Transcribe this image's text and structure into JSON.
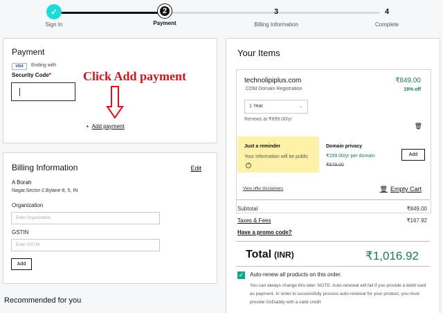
{
  "stepper": {
    "steps": [
      {
        "number": "✓",
        "label": "Sign In"
      },
      {
        "number": "2",
        "label": "Payment"
      },
      {
        "number": "3",
        "label": "Billing Information"
      },
      {
        "number": "4",
        "label": "Complete"
      }
    ]
  },
  "payment": {
    "title": "Payment",
    "card_brand": "VISA",
    "ending_text": "Ending with",
    "security_label": "Security Code",
    "required_mark": "*",
    "annotation": "Click Add payment",
    "add_payment_plus": "+",
    "add_payment_label": "Add payment"
  },
  "billing": {
    "title": "Billing Information",
    "edit_label": "Edit",
    "name": "A Borah",
    "address": "Nagar,Sector-2,Bylane-8,  5, IN",
    "organization_label": "Organization",
    "organization_placeholder": "Enter Organization",
    "gstin_label": "GSTIN",
    "gstin_placeholder": "Enter GSTIN",
    "add_label": "Add"
  },
  "recommended": {
    "title": "Recommended for you"
  },
  "items": {
    "title": "Your Items",
    "product": {
      "name": "technolipiplus.com",
      "price": "₹849.00",
      "description": ".COM Domain Registration",
      "discount": "19% off",
      "term": "1 Year",
      "renews": "Renews at ₹899.00/yr"
    },
    "reminder": {
      "title": "Just a reminder",
      "body": "Your information will be public"
    },
    "privacy": {
      "title": "Domain privacy",
      "price": "₹299.00/yr per domain",
      "old_price": "₹579.00",
      "add_label": "Add"
    },
    "disclaimers_label": "View offer disclaimers",
    "empty_cart_label": "Empty Cart",
    "subtotal_label": "Subtotal",
    "subtotal_value": "₹849.00",
    "taxes_label": "Taxes & Fees",
    "taxes_value": "₹167.92",
    "promo_label": "Have a promo code?",
    "total_label": "Total",
    "total_currency": "(INR)",
    "total_value": "₹1,016.92",
    "autorenew_label": "Auto-renew all products on this order.",
    "autorenew_note": "You can always change this later. NOTE: Auto-renewal will fail if you provide a debit card as payment. In order to successfully process auto-renewal for your product, you must provide GoDaddy with a valid credit"
  },
  "colors": {
    "accent_teal": "#1bdbdb",
    "price_green": "#1a7a5a",
    "annotation_red": "#e0101a",
    "reminder_yellow": "#fff2a8"
  }
}
